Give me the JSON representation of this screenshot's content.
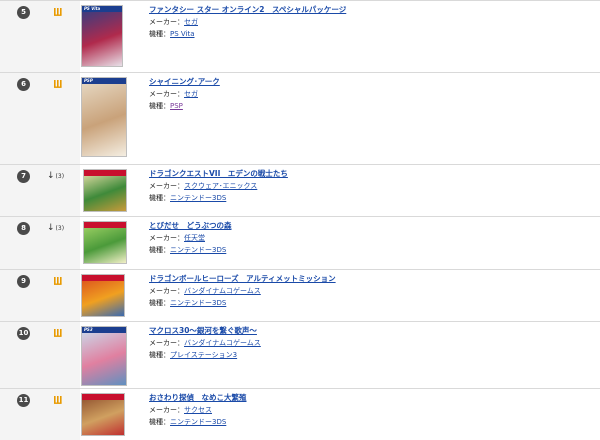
{
  "labels": {
    "maker": "メーカー：",
    "platform": "機種："
  },
  "rows": [
    {
      "rank": "5",
      "trend_type": "new",
      "trend_icon": "new-entry-icon",
      "trend_arrow": "",
      "trend_num": "",
      "title": "ファンタシー スター オンライン2　スペシャルパッケージ",
      "maker": "セガ",
      "platform": "PS Vita",
      "cover_platform_band": "PS Vita",
      "cover_colors": [
        "#2a3f86",
        "#b02a4c",
        "#e8e0e8"
      ]
    },
    {
      "rank": "6",
      "trend_type": "new",
      "trend_icon": "new-entry-icon",
      "trend_arrow": "",
      "trend_num": "",
      "title": "シャイニング･アーク",
      "maker": "セガ",
      "platform": "PSP",
      "cover_platform_band": "PSP",
      "cover_colors": [
        "#e8dcc8",
        "#c9a27a",
        "#f4eee2"
      ]
    },
    {
      "rank": "7",
      "trend_type": "down",
      "trend_icon": "down-arrow-icon",
      "trend_arrow": "↓",
      "trend_num": "(3)",
      "title": "ドラゴンクエストVII　エデンの戦士たち",
      "maker": "スクウェア･エニックス",
      "platform": "ニンテンドー3DS",
      "cover_platform_band": "",
      "cover_colors": [
        "#f2e6b0",
        "#3f8a3a",
        "#c89a3a"
      ]
    },
    {
      "rank": "8",
      "trend_type": "down",
      "trend_icon": "down-arrow-icon",
      "trend_arrow": "↓",
      "trend_num": "(3)",
      "title": "とびだせ　どうぶつの森",
      "maker": "任天堂",
      "platform": "ニンテンドー3DS",
      "cover_platform_band": "",
      "cover_colors": [
        "#a8d86a",
        "#4b9a3a",
        "#f2f0c8"
      ]
    },
    {
      "rank": "9",
      "trend_type": "new",
      "trend_icon": "new-entry-icon",
      "trend_arrow": "",
      "trend_num": "",
      "title": "ドラゴンボールヒーローズ　アルティメットミッション",
      "maker": "バンダイナムコゲームス",
      "platform": "ニンテンドー3DS",
      "cover_platform_band": "",
      "cover_colors": [
        "#d94a1e",
        "#f0a020",
        "#3a6ab0"
      ]
    },
    {
      "rank": "10",
      "trend_type": "new",
      "trend_icon": "new-entry-icon",
      "trend_arrow": "",
      "trend_num": "",
      "title": "マクロス30～銀河を繋ぐ歌声～",
      "maker": "バンダイナムコゲームス",
      "platform": "プレイステーション3",
      "cover_platform_band": "PS3",
      "cover_colors": [
        "#c8e0f0",
        "#e080a0",
        "#6090c0"
      ]
    },
    {
      "rank": "11",
      "trend_type": "new",
      "trend_icon": "new-entry-icon",
      "trend_arrow": "",
      "trend_num": "",
      "title": "おさわり探偵　なめこ大繁殖",
      "maker": "サクセス",
      "platform": "ニンテンドー3DS",
      "cover_platform_band": "",
      "cover_colors": [
        "#8a4a2a",
        "#d0a060",
        "#c03030"
      ]
    }
  ]
}
